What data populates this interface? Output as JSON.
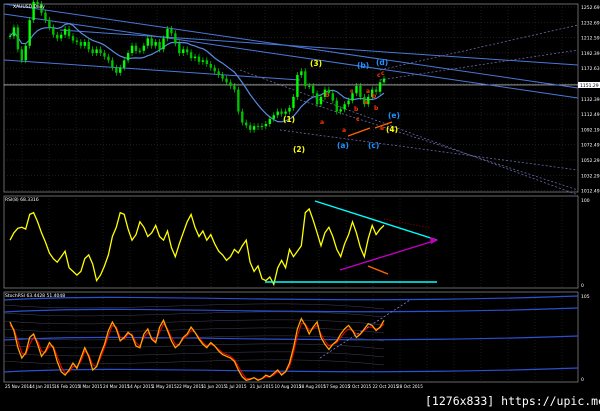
{
  "title": "XAUUSD,Daily",
  "colors": {
    "background": "#000000",
    "grid": "#3a3a3a",
    "bull": "#00ff00",
    "bear": "#00c000",
    "channel": "#4a78d8",
    "dotted": "#6a6aa8",
    "rsi": "#ffff00",
    "cyan": "#00ffff",
    "magenta": "#c000c0",
    "orange": "#ff6600",
    "stoch_main": "#ffa500",
    "stoch_signal": "#ff0000",
    "yellow_label": "#ffff00",
    "blue_label": "#1e90ff",
    "red_label": "#ff3300"
  },
  "price_axis": {
    "ticks": [
      "1252.69",
      "1232.69",
      "1212.59",
      "1192.39",
      "1172.63",
      "1152.49",
      "1132.39",
      "1112.49",
      "1092.19",
      "1072.49",
      "1052.29",
      "1032.29",
      "1012.49"
    ],
    "current": "1151.29"
  },
  "rsi_panel": {
    "label": "RSI(8) 68.3316",
    "top_tick": "100",
    "bottom_tick": "0"
  },
  "stoch_panel": {
    "label": "StochRSI 63.4428 51.4048",
    "top_tick": "105",
    "bottom_tick": "0"
  },
  "time_axis": [
    "25 Nov 2014",
    "14 Jan 2015",
    "16 Feb 2015",
    "4 Mar 2015",
    "24 Mar 2015",
    "14 Apr 2015",
    "1 May 2015",
    "22 May 2015",
    "11 Jun 2015",
    "1 Jul 2015",
    "21 Jul 2015",
    "10 Aug 2015",
    "28 Aug 2015",
    "17 Sep 2015",
    "2 Oct 2015",
    "22 Oct 2015",
    "28 Oct 2015"
  ],
  "watermark": "[1276x833] https://upic.me/",
  "wave_labels": [
    {
      "text": "(1)",
      "color": "yellow"
    },
    {
      "text": "(2)",
      "color": "yellow"
    },
    {
      "text": "(3)",
      "color": "yellow"
    },
    {
      "text": "(4)",
      "color": "yellow"
    },
    {
      "text": "(a)",
      "color": "blue"
    },
    {
      "text": "(b)",
      "color": "blue"
    },
    {
      "text": "(c)",
      "color": "blue"
    },
    {
      "text": "(d)",
      "color": "blue"
    },
    {
      "text": "(e)",
      "color": "blue"
    },
    {
      "text": "a",
      "color": "red"
    },
    {
      "text": "b",
      "color": "red"
    },
    {
      "text": "c",
      "color": "red"
    },
    {
      "text": "a",
      "color": "red"
    },
    {
      "text": "b",
      "color": "red"
    },
    {
      "text": "c",
      "color": "red"
    },
    {
      "text": "a",
      "color": "red"
    },
    {
      "text": "b",
      "color": "red"
    },
    {
      "text": "c",
      "color": "red"
    },
    {
      "text": "a",
      "color": "red"
    },
    {
      "text": "b",
      "color": "red"
    },
    {
      "text": "c",
      "color": "red"
    },
    {
      "text": "e",
      "color": "red"
    }
  ],
  "chart_data": [
    {
      "type": "line",
      "name_text": "XAUUSD,Daily",
      "ylim": [
        1005,
        1262
      ],
      "close": [
        1218,
        1230,
        1200,
        1185,
        1205,
        1240,
        1265,
        1262,
        1250,
        1240,
        1230,
        1220,
        1215,
        1220,
        1228,
        1218,
        1212,
        1210,
        1205,
        1210,
        1200,
        1195,
        1200,
        1195,
        1190,
        1185,
        1175,
        1168,
        1175,
        1185,
        1195,
        1205,
        1198,
        1198,
        1205,
        1215,
        1205,
        1210,
        1200,
        1215,
        1228,
        1222,
        1208,
        1195,
        1200,
        1196,
        1188,
        1190,
        1183,
        1185,
        1180,
        1175,
        1170,
        1165,
        1160,
        1155,
        1150,
        1145,
        1115,
        1100,
        1096,
        1090,
        1095,
        1094,
        1095,
        1098,
        1105,
        1110,
        1115,
        1112,
        1115,
        1120,
        1135,
        1165,
        1170,
        1150,
        1150,
        1140,
        1125,
        1135,
        1145,
        1140,
        1130,
        1115,
        1118,
        1125,
        1130,
        1140,
        1150,
        1135,
        1125,
        1135,
        1145,
        1142,
        1155,
        1160
      ]
    },
    {
      "type": "line",
      "name_text": "RSI(8) 68.3316",
      "ylim": [
        0,
        100
      ],
      "values": [
        52,
        60,
        65,
        66,
        64,
        80,
        82,
        72,
        60,
        50,
        38,
        32,
        28,
        34,
        40,
        22,
        18,
        14,
        18,
        32,
        36,
        26,
        8,
        14,
        24,
        36,
        56,
        66,
        82,
        80,
        64,
        52,
        58,
        72,
        66,
        56,
        60,
        68,
        56,
        52,
        62,
        44,
        34,
        48,
        60,
        72,
        80,
        66,
        56,
        62,
        52,
        58,
        48,
        40,
        36,
        30,
        34,
        42,
        38,
        46,
        52,
        28,
        18,
        24,
        10,
        8,
        12,
        4,
        22,
        30,
        22,
        42,
        34,
        40,
        46,
        82,
        86,
        74,
        60,
        46,
        60,
        66,
        56,
        42,
        34,
        48,
        58,
        72,
        60,
        44,
        34,
        54,
        68,
        58,
        64,
        68
      ]
    },
    {
      "type": "line",
      "name_text": "StochRSI 63.4428 51.4048",
      "ylim": [
        0,
        105
      ],
      "main": [
        70,
        60,
        40,
        28,
        34,
        52,
        56,
        44,
        30,
        36,
        46,
        40,
        24,
        12,
        8,
        14,
        22,
        16,
        28,
        40,
        30,
        14,
        18,
        32,
        44,
        60,
        70,
        62,
        48,
        52,
        58,
        54,
        42,
        40,
        56,
        62,
        50,
        46,
        64,
        72,
        60,
        48,
        40,
        44,
        52,
        56,
        64,
        58,
        50,
        44,
        40,
        46,
        42,
        36,
        32,
        30,
        28,
        24,
        14,
        6,
        2,
        3,
        5,
        2,
        4,
        8,
        6,
        10,
        14,
        8,
        12,
        22,
        40,
        62,
        74,
        66,
        56,
        64,
        70,
        52,
        44,
        38,
        44,
        48,
        56,
        62,
        66,
        60,
        52,
        56,
        62,
        68,
        66,
        60,
        64,
        72
      ],
      "signal": [
        66,
        62,
        48,
        34,
        32,
        44,
        52,
        48,
        36,
        34,
        42,
        42,
        30,
        18,
        10,
        12,
        18,
        18,
        24,
        36,
        32,
        20,
        18,
        28,
        40,
        54,
        66,
        64,
        52,
        50,
        56,
        56,
        46,
        42,
        52,
        58,
        52,
        48,
        58,
        68,
        62,
        52,
        44,
        44,
        50,
        54,
        60,
        58,
        52,
        46,
        42,
        44,
        42,
        38,
        34,
        32,
        30,
        26,
        18,
        10,
        4,
        4,
        5,
        3,
        4,
        6,
        6,
        8,
        12,
        10,
        12,
        18,
        34,
        54,
        68,
        68,
        60,
        62,
        66,
        56,
        48,
        42,
        44,
        46,
        52,
        58,
        62,
        60,
        56,
        56,
        60,
        64,
        64,
        62,
        63,
        68
      ]
    }
  ]
}
